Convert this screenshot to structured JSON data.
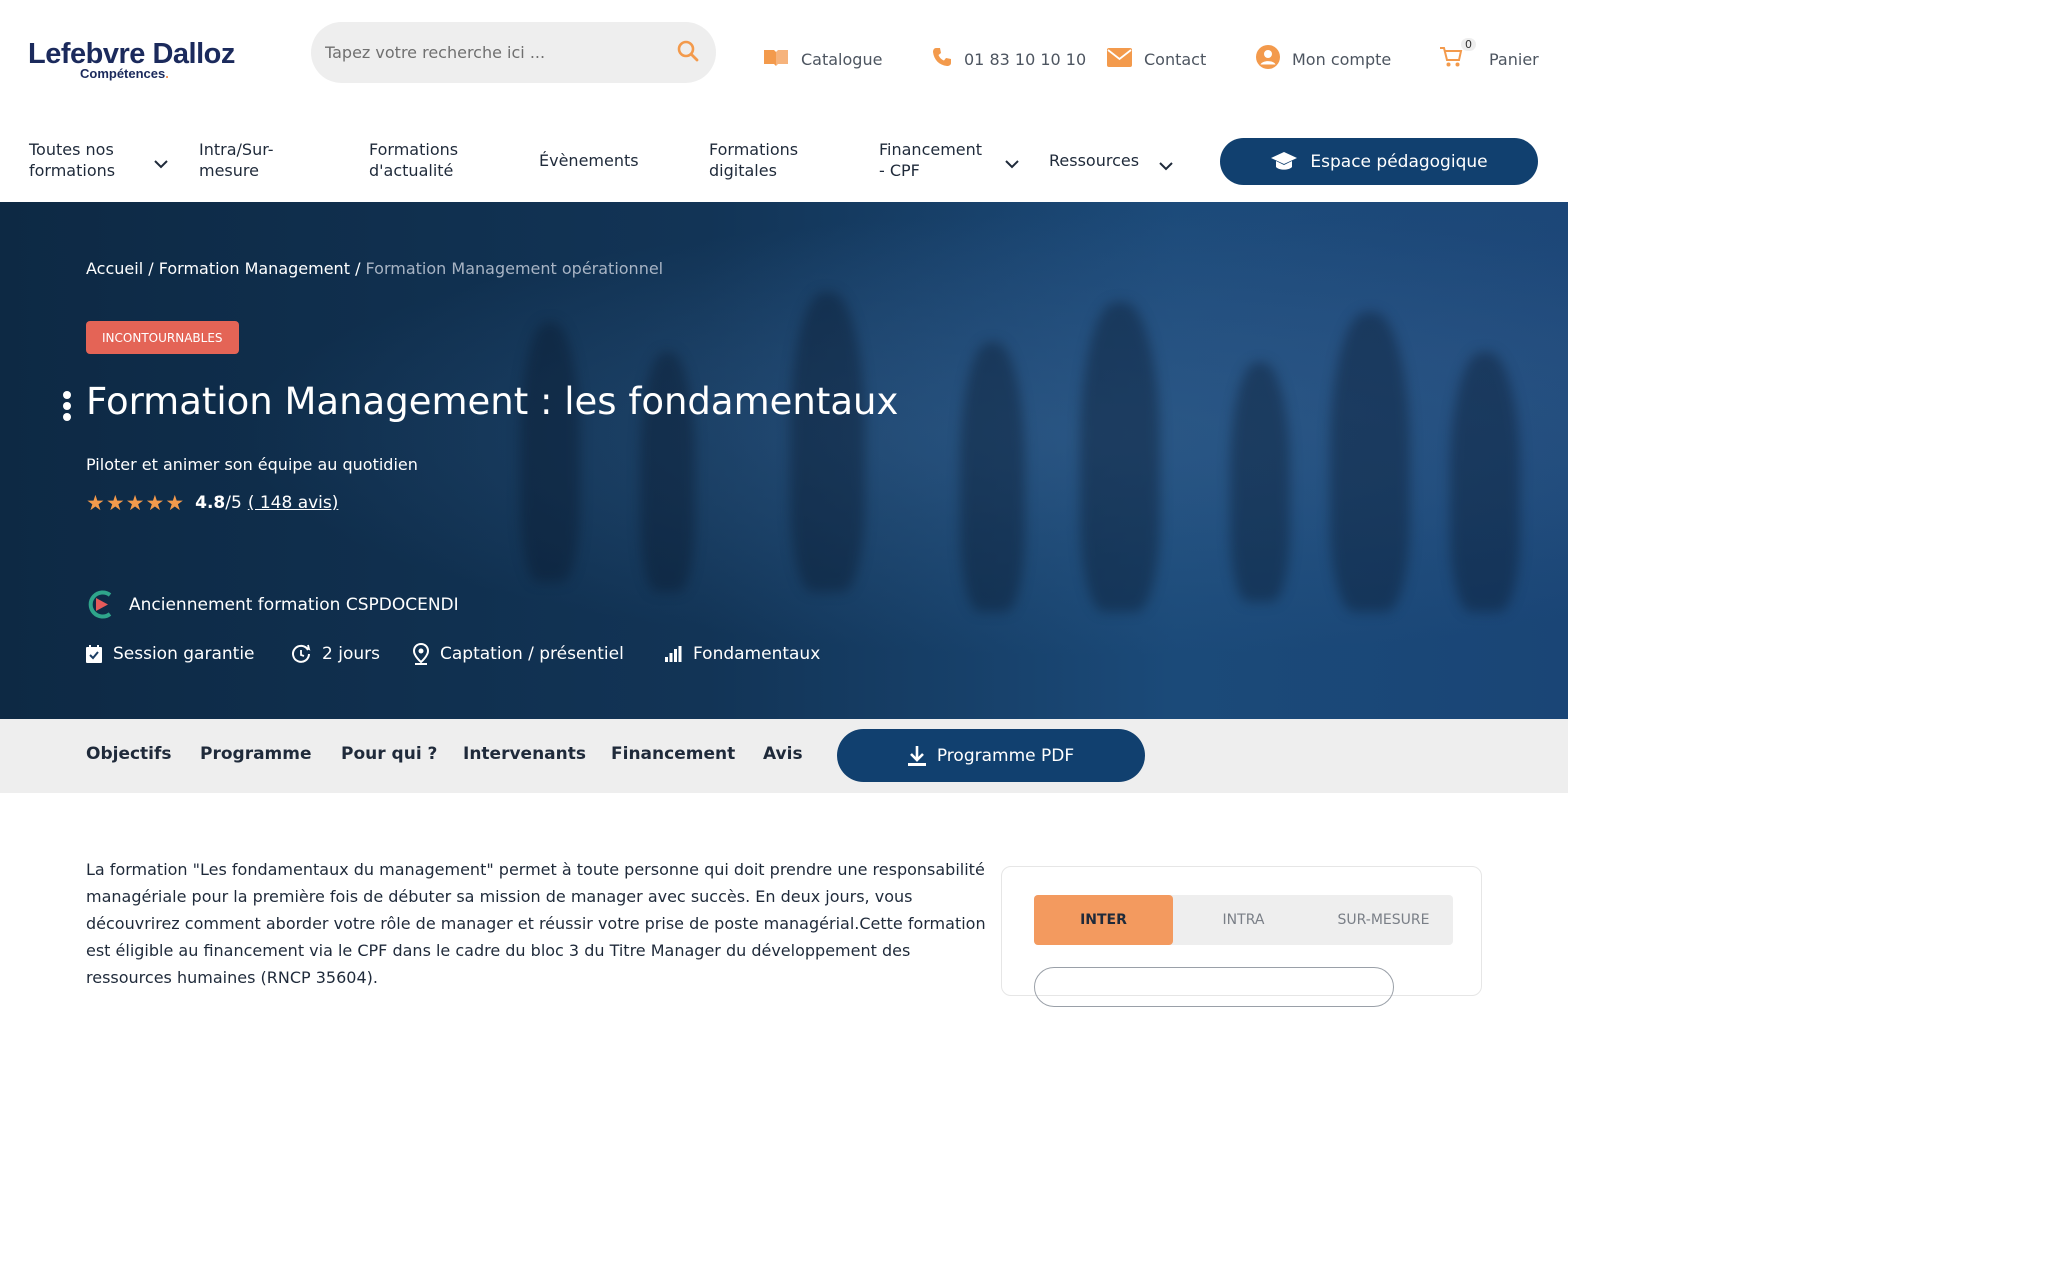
{
  "logo": {
    "brand": "Lefebvre Dalloz",
    "sub": "Compétences",
    "sub_dot": "."
  },
  "search": {
    "placeholder": "Tapez votre recherche ici ..."
  },
  "toplinks": {
    "catalogue": "Catalogue",
    "phone": "01 83 10 10 10",
    "contact": "Contact",
    "account": "Mon compte",
    "cart_label": "Panier",
    "cart_count": "0"
  },
  "nav": {
    "items": [
      {
        "line1": "Toutes nos",
        "line2": "formations"
      },
      {
        "line1": "Intra/Sur-",
        "line2": "mesure"
      },
      {
        "line1": "Formations",
        "line2": "d'actualité"
      },
      {
        "line1": "Évènements",
        "line2": ""
      },
      {
        "line1": "Formations",
        "line2": "digitales"
      },
      {
        "line1": "Financement",
        "line2": "- CPF"
      },
      {
        "line1": "Ressources",
        "line2": ""
      }
    ],
    "espace_label": "Espace pédagogique"
  },
  "hero": {
    "breadcrumb": {
      "home": "Accueil",
      "sep": "/",
      "parent": "Formation Management",
      "current": "Formation Management opérationnel"
    },
    "badge": "INCONTOURNABLES",
    "title": "Formation Management : les fondamentaux",
    "subtitle": "Piloter et animer son équipe au quotidien",
    "rating": {
      "stars": 5,
      "score": "4.8",
      "max": "/5",
      "reviews": "( 148 avis)"
    },
    "cert": "Anciennement formation CSPDOCENDI",
    "meta": {
      "session": "Session garantie",
      "duration": "2 jours",
      "mode": "Captation / présentiel",
      "level": "Fondamentaux"
    }
  },
  "tabs": {
    "items": [
      "Objectifs",
      "Programme",
      "Pour qui ?",
      "Intervenants",
      "Financement",
      "Avis"
    ],
    "pdf_label": "Programme PDF"
  },
  "content": {
    "description": "La formation \"Les fondamentaux du management\" permet à toute personne qui doit prendre une responsabilité managériale pour la première fois de débuter sa mission de manager avec succès. En deux jours, vous découvrirez comment aborder votre rôle de manager et réussir votre prise de poste managérial.Cette formation est éligible au financement via le CPF dans le cadre du bloc 3 du Titre Manager du développement des ressources humaines (RNCP 35604)."
  },
  "card": {
    "options": [
      "INTER",
      "INTRA",
      "SUR-MESURE"
    ],
    "active": "INTER"
  },
  "colors": {
    "primary": "#11406f",
    "accent": "#f39a4c",
    "badge": "#e46456",
    "surface": "#eeeeee"
  }
}
